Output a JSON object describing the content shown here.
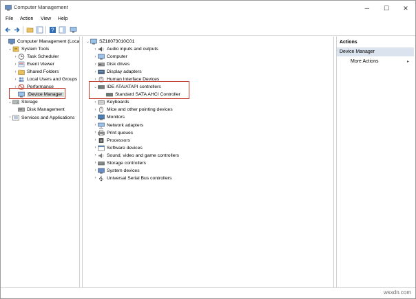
{
  "window": {
    "title": "Computer Management"
  },
  "menu": [
    "File",
    "Action",
    "View",
    "Help"
  ],
  "left_tree": [
    {
      "label": "Computer Management (Local)",
      "level": 0,
      "expander": "",
      "icon": "computer-management-icon"
    },
    {
      "label": "System Tools",
      "level": 1,
      "expander": "⌄",
      "icon": "tools-icon"
    },
    {
      "label": "Task Scheduler",
      "level": 2,
      "expander": "›",
      "icon": "clock-icon"
    },
    {
      "label": "Event Viewer",
      "level": 2,
      "expander": "›",
      "icon": "event-viewer-icon"
    },
    {
      "label": "Shared Folders",
      "level": 2,
      "expander": "›",
      "icon": "folder-icon"
    },
    {
      "label": "Local Users and Groups",
      "level": 2,
      "expander": "›",
      "icon": "users-icon"
    },
    {
      "label": "Performance",
      "level": 2,
      "expander": "›",
      "icon": "performance-icon"
    },
    {
      "label": "Device Manager",
      "level": 2,
      "expander": "",
      "icon": "device-manager-icon",
      "selected": true
    },
    {
      "label": "Storage",
      "level": 1,
      "expander": "⌄",
      "icon": "storage-icon"
    },
    {
      "label": "Disk Management",
      "level": 2,
      "expander": "",
      "icon": "disk-icon"
    },
    {
      "label": "Services and Applications",
      "level": 1,
      "expander": "›",
      "icon": "services-icon"
    }
  ],
  "device_tree": {
    "root": "SZ18073010C01",
    "items": [
      {
        "label": "Audio inputs and outputs",
        "icon": "speaker-icon",
        "expander": "›"
      },
      {
        "label": "Computer",
        "icon": "computer-icon",
        "expander": "›"
      },
      {
        "label": "Disk drives",
        "icon": "disk-drive-icon",
        "expander": "›"
      },
      {
        "label": "Display adapters",
        "icon": "display-icon",
        "expander": "›"
      },
      {
        "label": "Human Interface Devices",
        "icon": "hid-icon",
        "expander": "›"
      },
      {
        "label": "IDE ATA/ATAPI controllers",
        "icon": "controller-icon",
        "expander": "⌄"
      },
      {
        "label": "Standard SATA AHCI Controller",
        "icon": "controller-icon",
        "expander": "",
        "child": true
      },
      {
        "label": "Keyboards",
        "icon": "keyboard-icon",
        "expander": "›"
      },
      {
        "label": "Mice and other pointing devices",
        "icon": "mouse-icon",
        "expander": "›"
      },
      {
        "label": "Monitors",
        "icon": "monitor-icon",
        "expander": "›"
      },
      {
        "label": "Network adapters",
        "icon": "network-icon",
        "expander": "›"
      },
      {
        "label": "Print queues",
        "icon": "printer-icon",
        "expander": "›"
      },
      {
        "label": "Processors",
        "icon": "processor-icon",
        "expander": "›"
      },
      {
        "label": "Software devices",
        "icon": "software-icon",
        "expander": "›"
      },
      {
        "label": "Sound, video and game controllers",
        "icon": "sound-icon",
        "expander": "›"
      },
      {
        "label": "Storage controllers",
        "icon": "storage-controller-icon",
        "expander": "›"
      },
      {
        "label": "System devices",
        "icon": "system-icon",
        "expander": "›"
      },
      {
        "label": "Universal Serial Bus controllers",
        "icon": "usb-icon",
        "expander": "›"
      }
    ]
  },
  "actions": {
    "header": "Actions",
    "section": "Device Manager",
    "items": [
      "More Actions"
    ],
    "more_arrow": "▸"
  },
  "watermark": "wsxdn.com",
  "colors": {
    "highlight": "#c0392b",
    "selected_bg": "#d9d9d9",
    "actions_section_bg": "#dbe4ee"
  }
}
